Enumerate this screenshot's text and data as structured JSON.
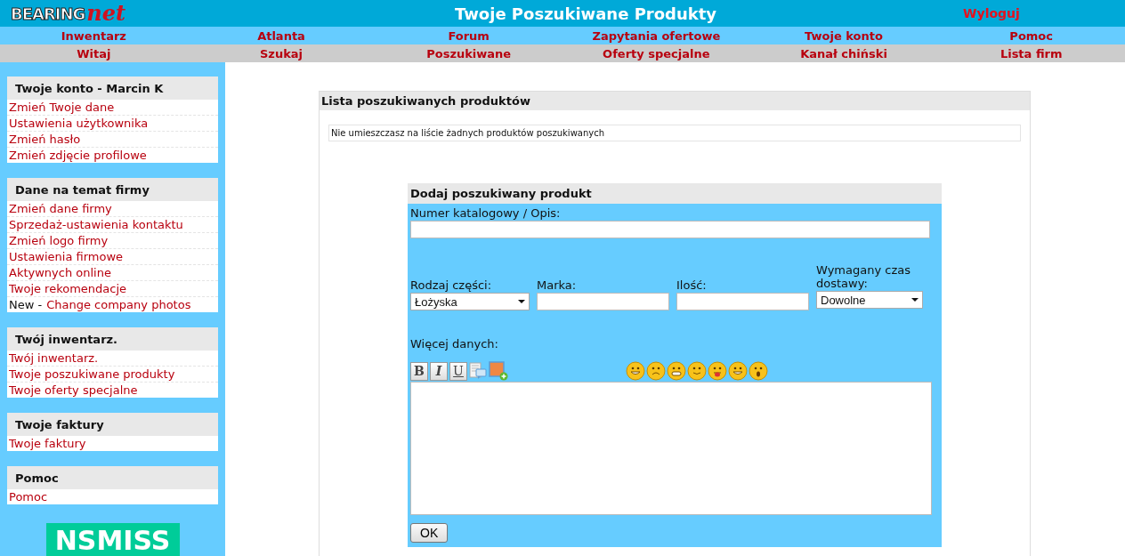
{
  "header": {
    "logo_word": "BEARING",
    "logo_suffix": "net",
    "title": "Twoje Poszukiwane Produkty",
    "logout": "Wyloguj"
  },
  "nav_primary": [
    "Inwentarz",
    "Atlanta",
    "Forum",
    "Zapytania ofertowe",
    "Twoje konto",
    "Pomoc"
  ],
  "nav_secondary": [
    "Witaj",
    "Szukaj",
    "Poszukiwane",
    "Oferty specjalne",
    "Kanał chiński",
    "Lista firm"
  ],
  "sidebar": [
    {
      "title": "Twoje konto - Marcin K",
      "items": [
        {
          "label": "Zmień Twoje dane"
        },
        {
          "label": "Ustawienia użytkownika"
        },
        {
          "label": "Zmień hasło"
        },
        {
          "label": "Zmień zdjęcie profilowe"
        }
      ]
    },
    {
      "title": "Dane na temat firmy",
      "items": [
        {
          "label": "Zmień dane firmy"
        },
        {
          "label": "Sprzedaż-ustawienia kontaktu"
        },
        {
          "label": "Zmień logo firmy"
        },
        {
          "label": "Ustawienia firmowe"
        },
        {
          "label": "Aktywnych online"
        },
        {
          "label": "Twoje rekomendacje"
        },
        {
          "prefix": "New -",
          "label": "Change company photos"
        }
      ]
    },
    {
      "title": "Twój inwentarz.",
      "items": [
        {
          "label": "Twój inwentarz."
        },
        {
          "label": "Twoje poszukiwane produkty"
        },
        {
          "label": "Twoje oferty specjalne"
        }
      ]
    },
    {
      "title": "Twoje faktury",
      "items": [
        {
          "label": "Twoje faktury"
        }
      ]
    },
    {
      "title": "Pomoc",
      "items": [
        {
          "label": "Pomoc"
        }
      ]
    }
  ],
  "banner": "NSMISS",
  "list_panel": {
    "title": "Lista poszukiwanych produktów",
    "message": "Nie umieszczasz na liście żadnych produktów poszukiwanych"
  },
  "form": {
    "title": "Dodaj poszukiwany produkt",
    "fields": [
      {
        "kind": "wide_text",
        "label": "Numer katalogowy / Opis:"
      },
      {
        "kind": "select",
        "label": "Rodzaj części:",
        "value": "Łożyska"
      },
      {
        "kind": "text",
        "label": "Marka:"
      },
      {
        "kind": "text",
        "label": "Ilość:"
      },
      {
        "kind": "select",
        "label": "Wymagany czas dostawy:",
        "value": "Dowolne"
      }
    ],
    "more_label": "Więcej danych:",
    "format_buttons": [
      "B",
      "I",
      "U"
    ],
    "submit": "OK"
  }
}
